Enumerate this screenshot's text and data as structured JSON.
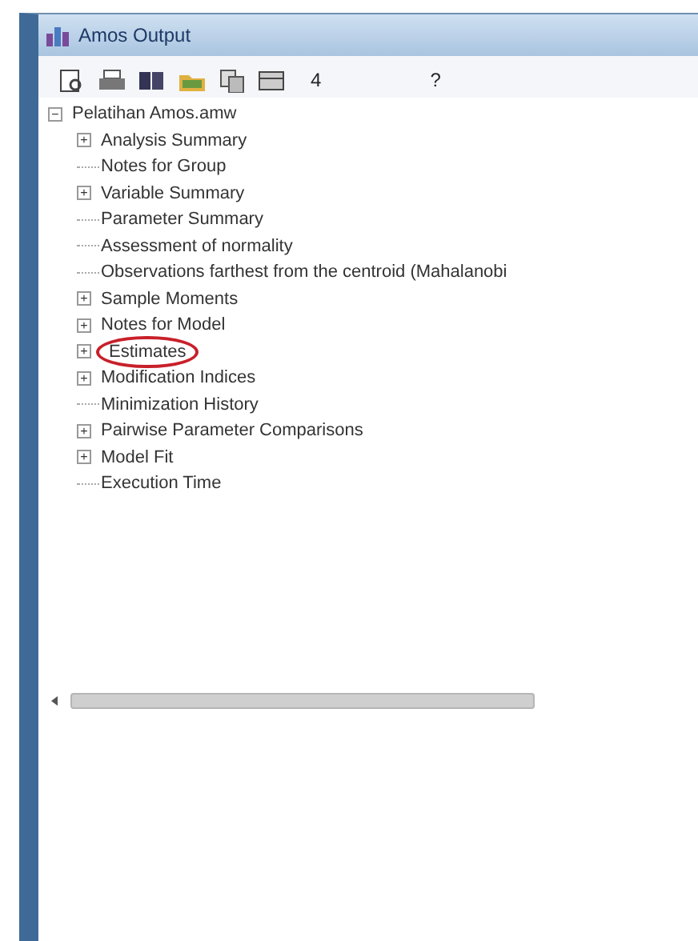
{
  "window": {
    "title": "Amos Output"
  },
  "toolbar": {
    "count": "4",
    "help": "?"
  },
  "tree": {
    "toggle": "−",
    "label": "Pelatihan Amos.amw",
    "children": [
      {
        "toggle": "+",
        "label": "Analysis Summary",
        "circled": false
      },
      {
        "label": "Notes for Group",
        "circled": false
      },
      {
        "toggle": "+",
        "label": "Variable Summary",
        "circled": false
      },
      {
        "label": "Parameter Summary",
        "circled": false
      },
      {
        "label": "Assessment of normality",
        "circled": false
      },
      {
        "label": "Observations farthest from the centroid (Mahalanobi",
        "circled": false
      },
      {
        "toggle": "+",
        "label": "Sample Moments",
        "circled": false
      },
      {
        "toggle": "+",
        "label": "Notes for Model",
        "circled": false
      },
      {
        "toggle": "+",
        "label": "Estimates",
        "circled": true
      },
      {
        "toggle": "+",
        "label": "Modification Indices",
        "circled": false
      },
      {
        "label": "Minimization History",
        "circled": false
      },
      {
        "toggle": "+",
        "label": "Pairwise Parameter Comparisons",
        "circled": false
      },
      {
        "toggle": "+",
        "label": "Model Fit",
        "circled": false
      },
      {
        "label": "Execution Time",
        "circled": false
      }
    ]
  }
}
